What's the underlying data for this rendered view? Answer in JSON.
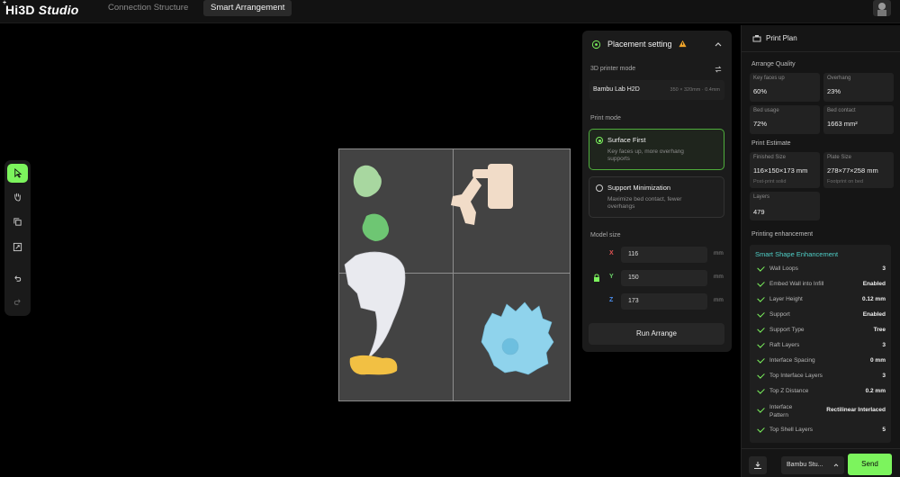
{
  "app": {
    "logo_main": "Hi3D",
    "logo_italic": "Studio",
    "logo_plus": "+"
  },
  "tabs": [
    {
      "label": "Connection Structure",
      "active": false
    },
    {
      "label": "Smart Arrangement",
      "active": true
    }
  ],
  "toolbar": {
    "tools": [
      "select-arrow-icon",
      "hand-pan-icon",
      "copy-icon",
      "scale-icon",
      "undo-icon",
      "redo-icon"
    ],
    "active_color": "#7cf45d"
  },
  "placement": {
    "title": "Placement setting",
    "printer_mode_label": "3D printer mode",
    "printer_name": "Bambu Lab H2D",
    "printer_size": "350 × 320mm · 0.4mm",
    "print_mode_label": "Print mode",
    "modes": [
      {
        "name": "Surface First",
        "desc": "Key faces up, more overhang supports",
        "selected": true
      },
      {
        "name": "Support Minimization",
        "desc": "Maximize bed contact, fewer overhangs",
        "selected": false
      }
    ],
    "model_size_label": "Model size",
    "axes": [
      {
        "axis": "X",
        "value": "116",
        "unit": "mm",
        "color": "#e45353"
      },
      {
        "axis": "Y",
        "value": "150",
        "unit": "mm",
        "color": "#6cd36a"
      },
      {
        "axis": "Z",
        "value": "173",
        "unit": "mm",
        "color": "#4c8ff0"
      }
    ],
    "run_label": "Run Arrange"
  },
  "plan": {
    "title": "Print Plan",
    "quality_label": "Arrange Quality",
    "quality_cards": [
      {
        "label": "Key faces up",
        "value": "60%"
      },
      {
        "label": "Overhang",
        "value": "23%"
      },
      {
        "label": "Bed usage",
        "value": "72%"
      },
      {
        "label": "Bed contact",
        "value": "1663 mm²"
      }
    ],
    "estimate_label": "Print Estimate",
    "estimate_cards": [
      {
        "label": "Finished Size",
        "value": "116×150×173 mm",
        "sub": "Post-print solid"
      },
      {
        "label": "Plate Size",
        "value": "278×77×258 mm",
        "sub": "Footprint on bed"
      },
      {
        "label": "Layers",
        "value": "479",
        "sub": ""
      }
    ],
    "enhancement_label": "Printing enhancement",
    "enhancement_title": "Smart Shape Enhancement",
    "enhancements": [
      {
        "name": "Wall Loops",
        "value": "3"
      },
      {
        "name": "Embed Wall into Infill",
        "value": "Enabled"
      },
      {
        "name": "Layer Height",
        "value": "0.12 mm"
      },
      {
        "name": "Support",
        "value": "Enabled"
      },
      {
        "name": "Support Type",
        "value": "Tree"
      },
      {
        "name": "Raft Layers",
        "value": "3"
      },
      {
        "name": "Interface Spacing",
        "value": "0 mm"
      },
      {
        "name": "Top Interface Layers",
        "value": "3"
      },
      {
        "name": "Top Z Distance",
        "value": "0.2 mm"
      },
      {
        "name": "Interface Pattern",
        "value": "Rectilinear Interlaced"
      },
      {
        "name": "Top Shell Layers",
        "value": "5"
      }
    ],
    "printer_select": "Bambu Stu...",
    "send_label": "Send"
  },
  "colors": {
    "accent": "#7cf45d",
    "teal": "#4fd0c8",
    "warning": "#f0a52a"
  }
}
